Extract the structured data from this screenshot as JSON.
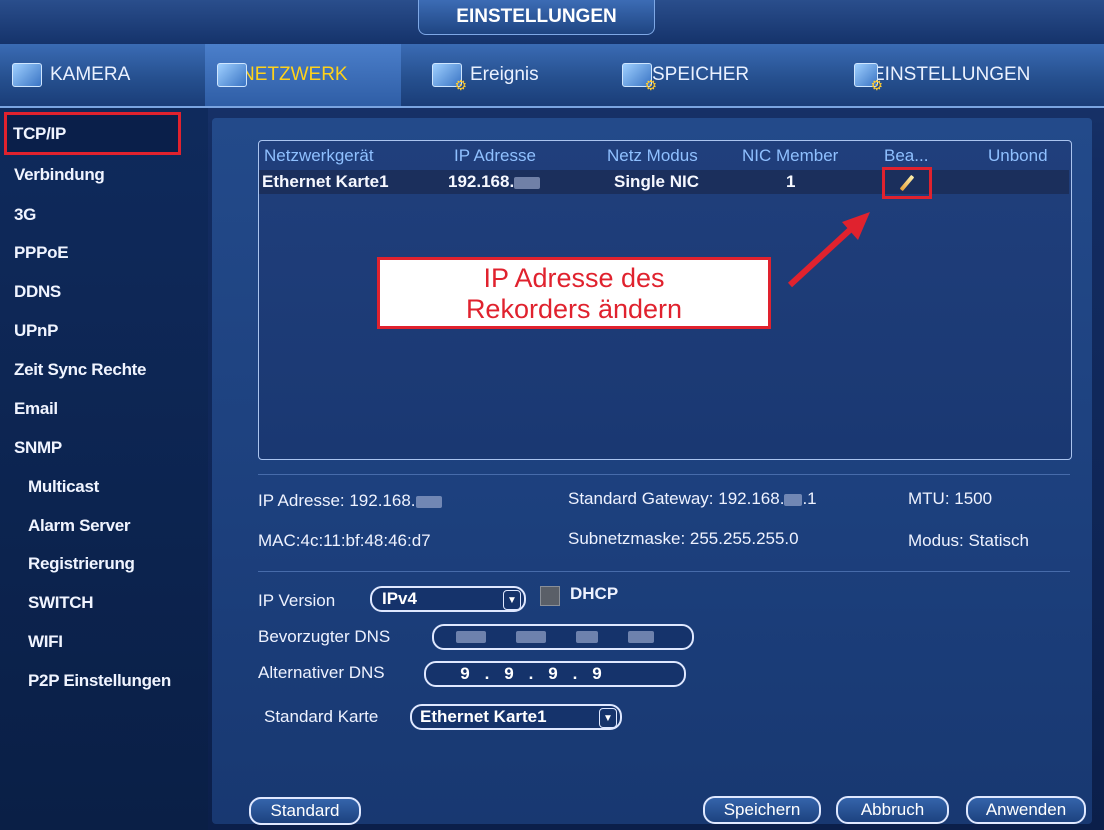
{
  "window": {
    "title": "EINSTELLUNGEN"
  },
  "tabs": [
    {
      "label": "KAMERA",
      "icon": "camera-icon"
    },
    {
      "label": "NETZWERK",
      "icon": "network-icon",
      "active": true
    },
    {
      "label": "Ereignis",
      "icon": "event-icon"
    },
    {
      "label": "SPEICHER",
      "icon": "storage-icon"
    },
    {
      "label": "EINSTELLUNGEN",
      "icon": "settings-icon"
    }
  ],
  "sidebar": {
    "items": [
      "TCP/IP",
      "Verbindung",
      "3G",
      "PPPoE",
      "DDNS",
      "UPnP",
      "Zeit Sync Rechte",
      "Email",
      "SNMP",
      "Multicast",
      "Alarm Server",
      "Registrierung",
      "SWITCH",
      "WIFI",
      "P2P Einstellungen"
    ],
    "active": "TCP/IP"
  },
  "table": {
    "headers": [
      "Netzwerkgerät",
      "IP Adresse",
      "Netz Modus",
      "NIC Member",
      "Bea...",
      "Unbond"
    ],
    "rows": [
      {
        "device": "Ethernet Karte1",
        "ip": "192.168.",
        "mode": "Single NIC",
        "nic_member": "1"
      }
    ]
  },
  "callout": {
    "line1": "IP Adresse des",
    "line2": "Rekorders ändern"
  },
  "info": {
    "ip": "IP Adresse: 192.168.",
    "gateway": "Standard Gateway: 192.168.",
    "gateway_suffix": ".1",
    "mtu": "MTU: 1500",
    "mac": "MAC:4c:11:bf:48:46:d7",
    "subnet": "Subnetzmaske: 255.255.255.0",
    "mode": "Modus: Statisch"
  },
  "form": {
    "ip_version_label": "IP Version",
    "ip_version_value": "IPv4",
    "dhcp_label": "DHCP",
    "preferred_dns_label": "Bevorzugter DNS",
    "alt_dns_label": "Alternativer DNS",
    "alt_dns": [
      "9",
      "9",
      "9",
      "9"
    ],
    "default_card_label": "Standard Karte",
    "default_card_value": "Ethernet Karte1"
  },
  "buttons": {
    "standard": "Standard",
    "save": "Speichern",
    "cancel": "Abbruch",
    "apply": "Anwenden"
  },
  "colors": {
    "highlight_red": "#e0222e",
    "active_tab_text": "#ffd21a",
    "header_text": "#8fc0ff"
  }
}
